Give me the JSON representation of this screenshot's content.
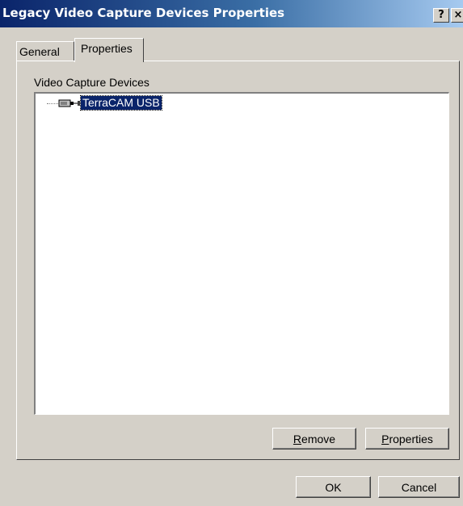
{
  "window": {
    "title": "Legacy Video Capture Devices Properties"
  },
  "caption_buttons": {
    "help": "?",
    "close": "×"
  },
  "tabs": [
    {
      "label": "General",
      "selected": false
    },
    {
      "label": "Properties",
      "selected": true
    }
  ],
  "group": {
    "label": "Video Capture Devices"
  },
  "tree": {
    "items": [
      {
        "label": "TerraCAM USB",
        "icon": "video-device-icon",
        "selected": true
      }
    ]
  },
  "buttons": {
    "remove": {
      "mnemonic": "R",
      "rest": "emove"
    },
    "properties": {
      "mnemonic": "P",
      "rest": "roperties"
    },
    "ok": "OK",
    "cancel": "Cancel"
  },
  "colors": {
    "titlebar_start": "#0a246a",
    "titlebar_end": "#a6caf0",
    "face": "#d4d0c8",
    "selection": "#0a246a"
  }
}
